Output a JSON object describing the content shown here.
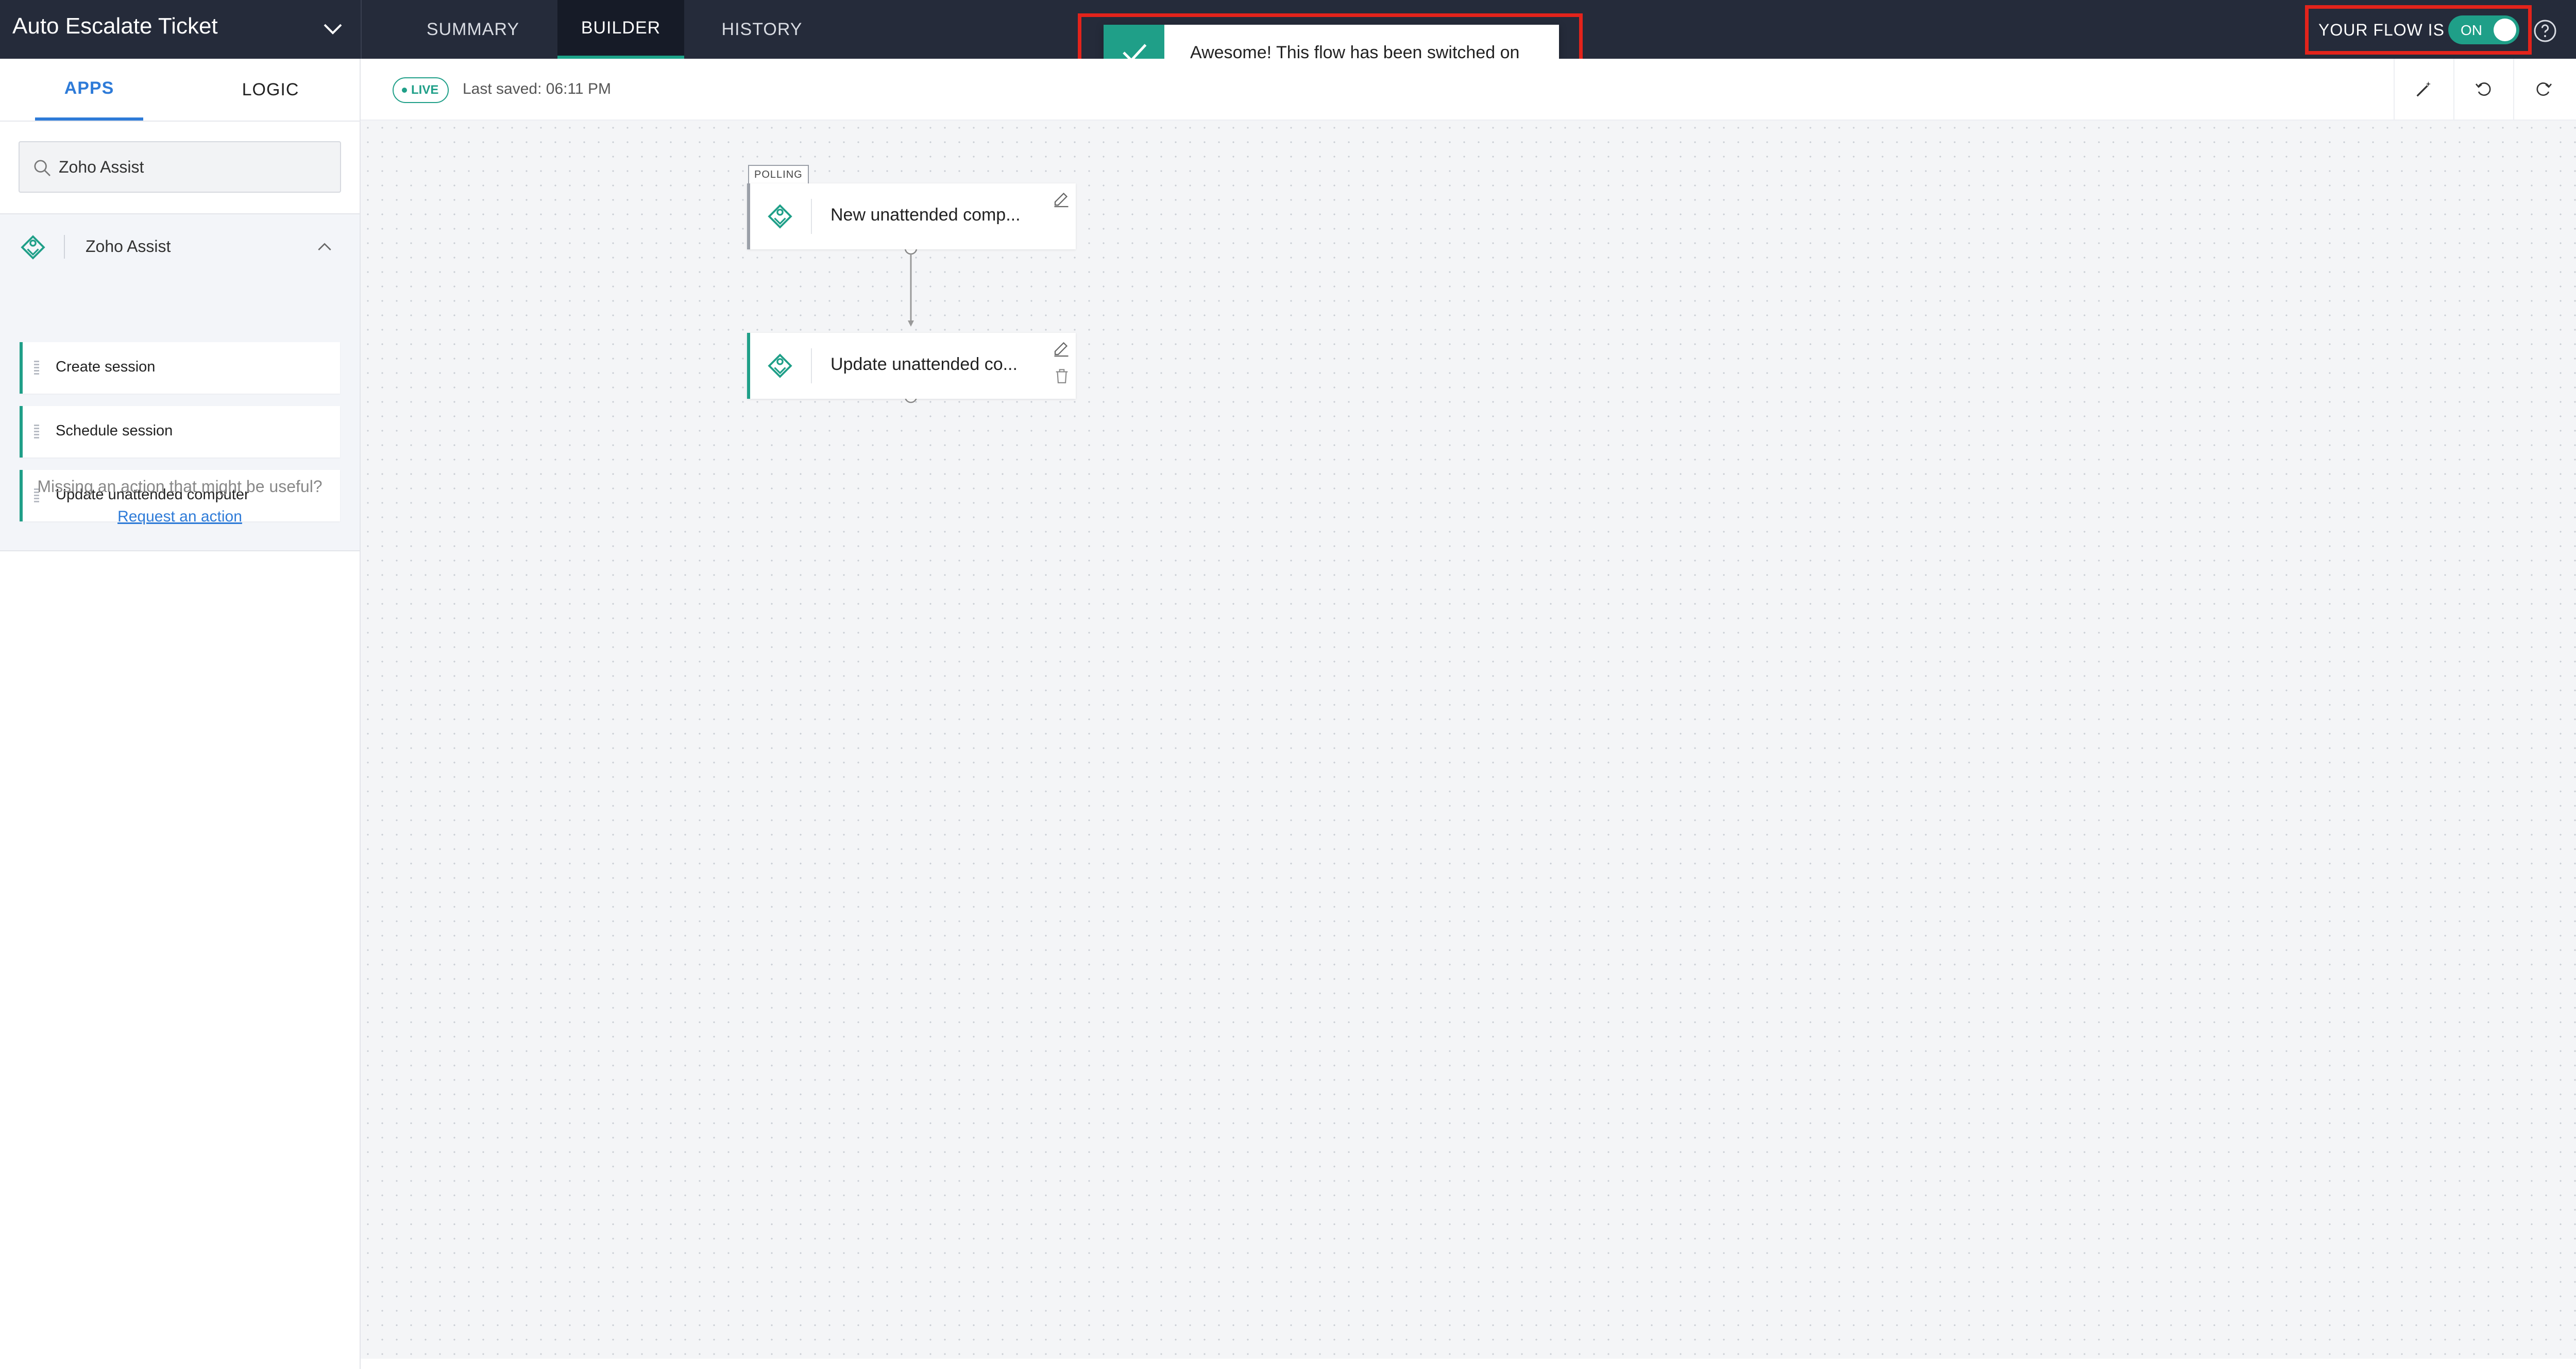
{
  "header": {
    "title": "Auto Escalate Ticket",
    "tabs": [
      {
        "label": "SUMMARY",
        "active": false
      },
      {
        "label": "BUILDER",
        "active": true
      },
      {
        "label": "HISTORY",
        "active": false
      }
    ],
    "flow_status_label": "YOUR FLOW IS",
    "flow_toggle_label": "ON"
  },
  "toast": {
    "message": "Awesome! This flow has been switched on"
  },
  "sidebar": {
    "tabs": [
      {
        "label": "APPS",
        "active": true
      },
      {
        "label": "LOGIC",
        "active": false
      }
    ],
    "search": {
      "value": "Zoho Assist"
    },
    "app": {
      "name": "Zoho Assist",
      "actions": [
        "Create session",
        "Schedule session",
        "Update unattended computer"
      ]
    },
    "missing_text": "Missing an action that might be useful?",
    "request_link": "Request an action"
  },
  "toolbar": {
    "live_label": "LIVE",
    "last_saved": "Last saved: 06:11 PM"
  },
  "canvas": {
    "trigger": {
      "tag": "POLLING",
      "label": "New unattended comp..."
    },
    "action": {
      "label": "Update unattended co..."
    }
  },
  "colors": {
    "accent": "#1f9f88",
    "topbar": "#252b3a",
    "highlight": "#e3231b",
    "link": "#2e7bd8"
  },
  "icons": [
    "chevron-down-icon",
    "check-icon",
    "help-icon",
    "close-icon",
    "search-icon",
    "zoho-assist-icon",
    "chevron-up-icon",
    "magic-wand-icon",
    "undo-icon",
    "redo-icon",
    "play-icon",
    "edit-icon",
    "delete-icon"
  ]
}
